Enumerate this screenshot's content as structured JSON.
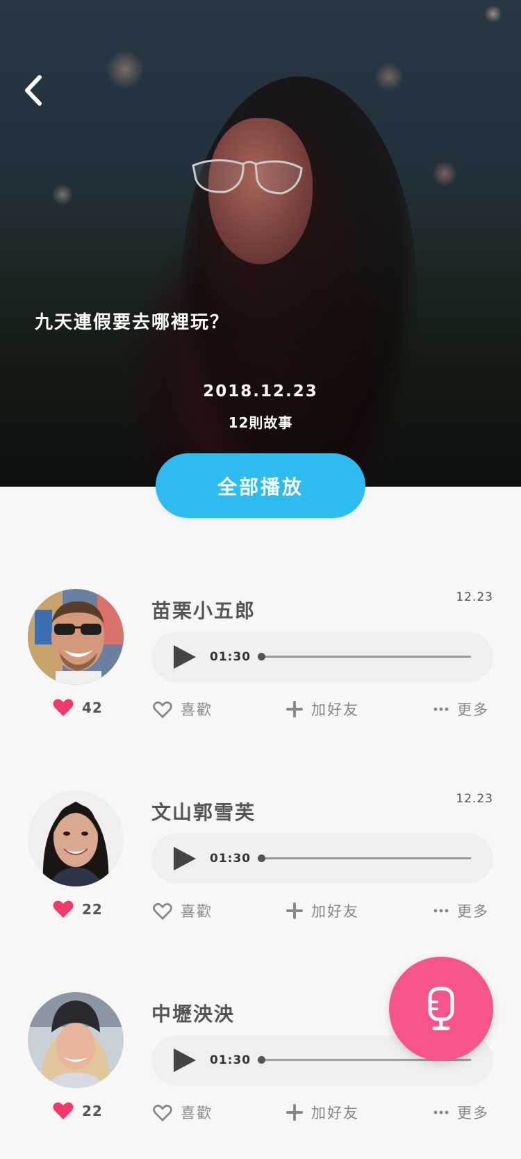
{
  "header": {
    "title": "九天連假要去哪裡玩？",
    "date": "2018.12.23",
    "story_count": "12則故事",
    "play_all_label": "全部播放"
  },
  "actions": {
    "like_label": "喜歡",
    "add_friend_label": "加好友",
    "more_label": "更多"
  },
  "stories": [
    {
      "author": "苗栗小五郎",
      "date": "12.23",
      "duration": "01:30",
      "likes": "42"
    },
    {
      "author": "文山郭雪芙",
      "date": "12.23",
      "duration": "01:30",
      "likes": "22"
    },
    {
      "author": "中壢泱泱",
      "date": "",
      "duration": "01:30",
      "likes": "22"
    }
  ],
  "colors": {
    "accent_blue": "#2ebcf0",
    "accent_pink": "#f5558a",
    "like_red": "#f5386a"
  },
  "icons": [
    "chevron-left-icon",
    "play-icon",
    "heart-filled-icon",
    "heart-outline-icon",
    "plus-icon",
    "ellipsis-icon",
    "microphone-icon"
  ]
}
